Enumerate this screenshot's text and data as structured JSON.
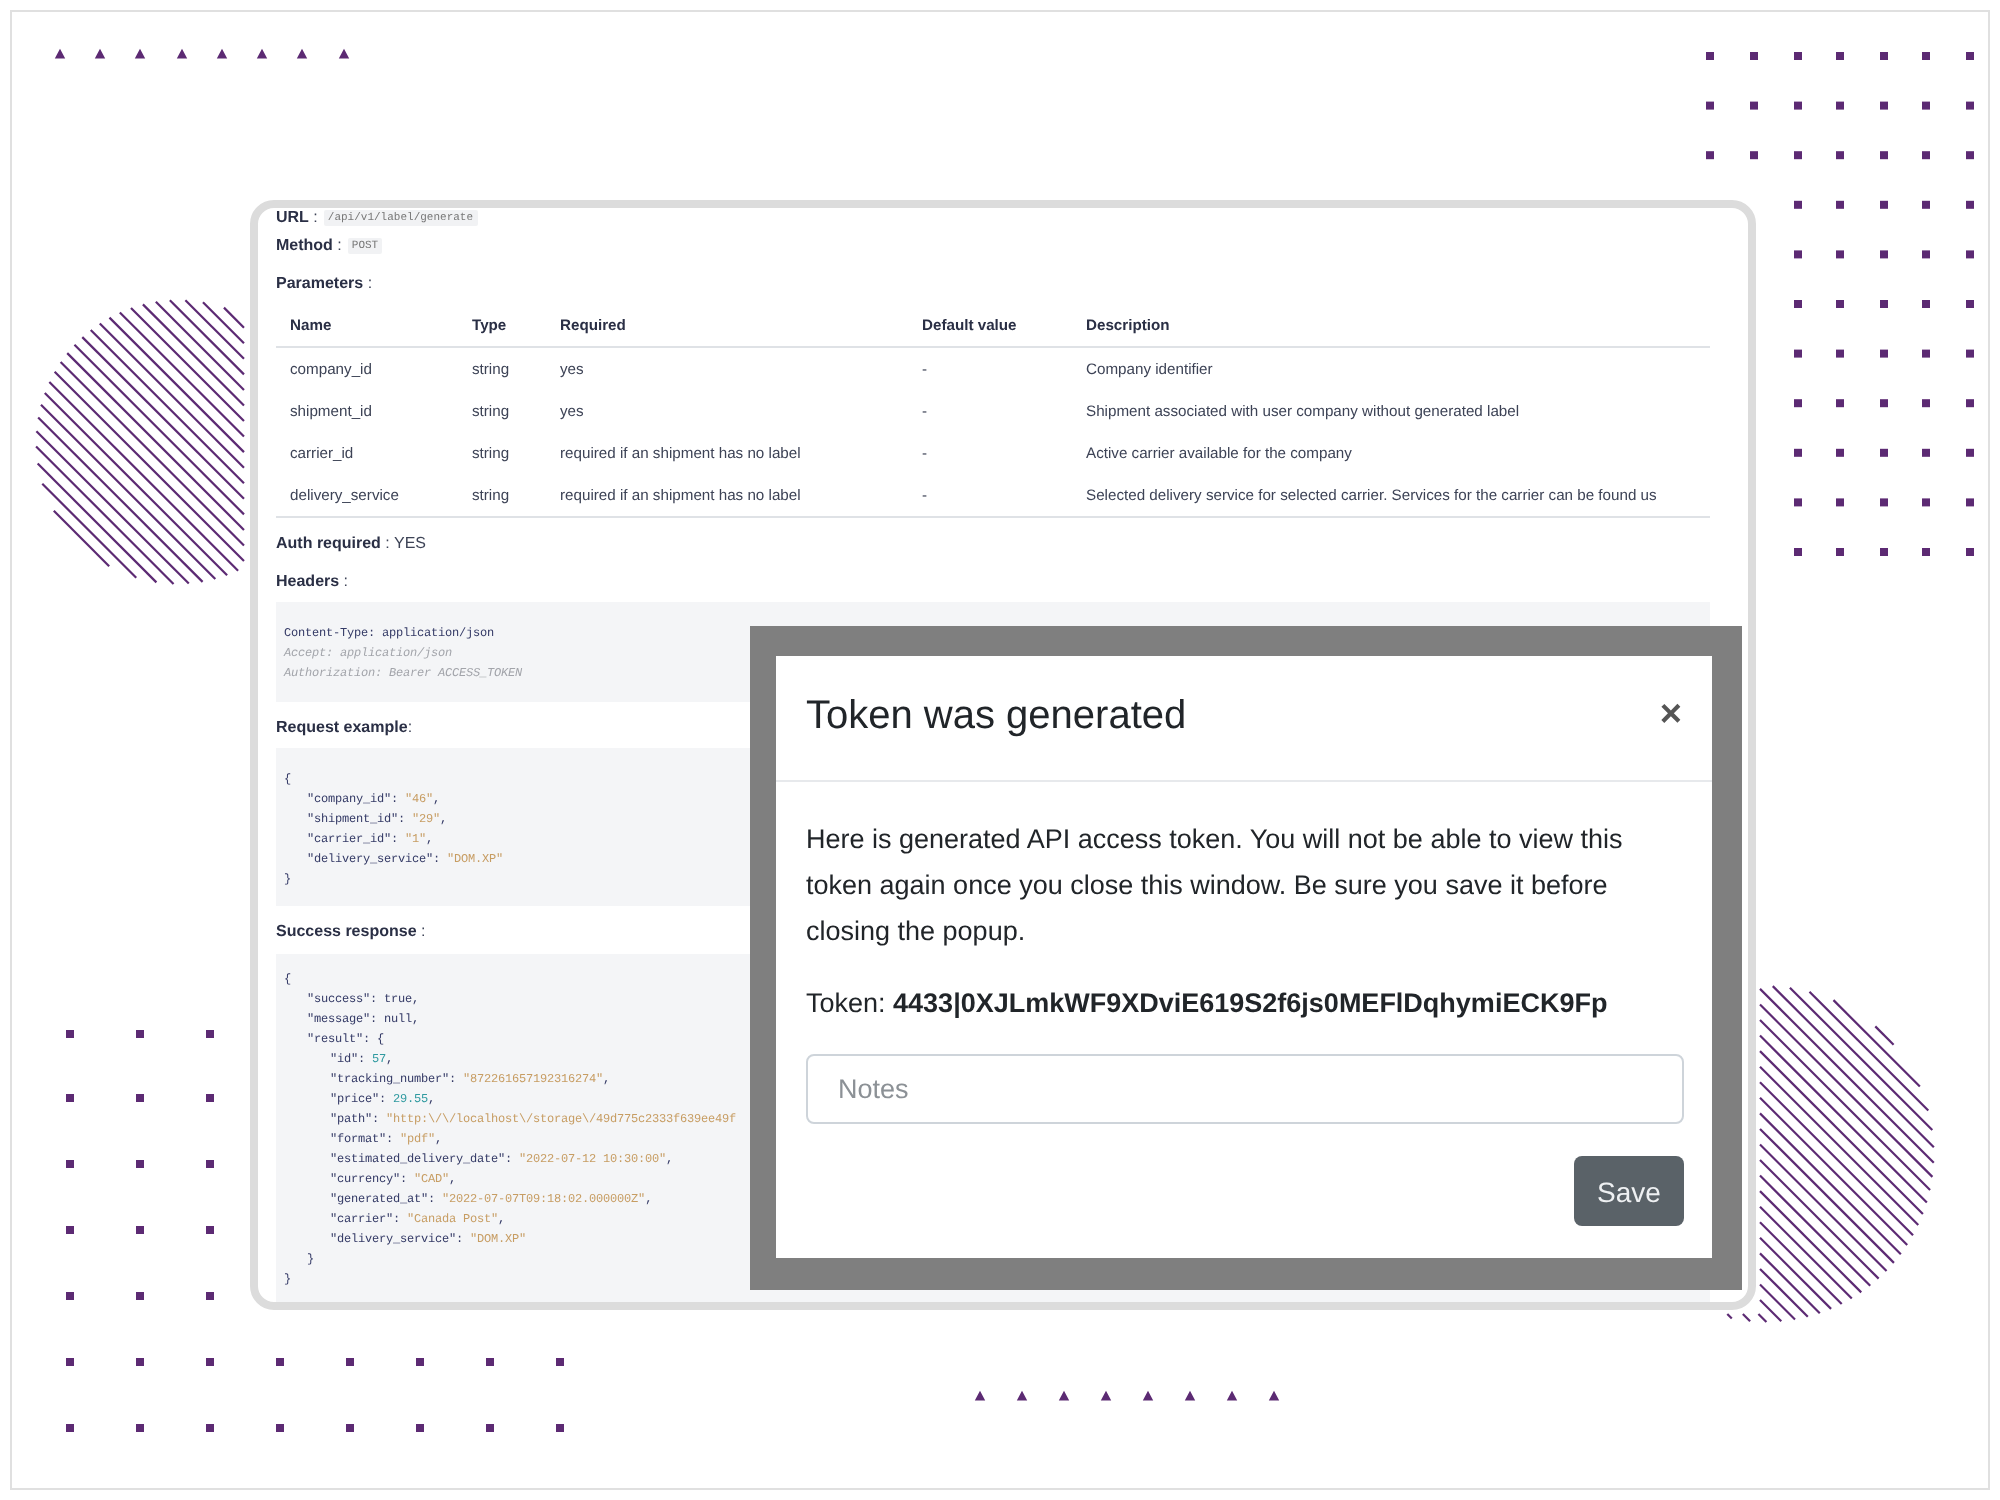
{
  "api_doc": {
    "url": {
      "label": "**URL** :",
      "value": "/api/v1/label/generate"
    },
    "method": {
      "label": "**Method** :",
      "value": "POST"
    },
    "parameters": {
      "heading": "**Parameters** :",
      "columns": [
        "Name",
        "Type",
        "Required",
        "Default value",
        "Description"
      ],
      "rows": [
        [
          "company_id",
          "string",
          "yes",
          "-",
          "Company identifier"
        ],
        [
          "shipment_id",
          "string",
          "yes",
          "-",
          "Shipment associated with user company without generated label"
        ],
        [
          "carrier_id",
          "string",
          "required if an shipment has no label",
          "-",
          "Active carrier available for the company"
        ],
        [
          "delivery_service",
          "string",
          "required if an shipment has no label",
          "-",
          "Selected delivery service for selected carrier. Services for the carrier can be found us"
        ]
      ]
    },
    "auth_required": "**Auth required** : YES",
    "headers": {
      "heading": "**Headers** :",
      "lines": [
        {
          "kind": "header",
          "text": "Content-Type: application/json"
        },
        {
          "kind": "comment",
          "text": "Accept: application/json"
        },
        {
          "kind": "comment",
          "text": "Authorization: Bearer ACCESS_TOKEN"
        }
      ]
    },
    "request_example": {
      "heading": "**Request example**:",
      "code": [
        {
          "kind": "brace",
          "text": "{",
          "children": [
            {
              "kind": "string",
              "key": "\"company_id\":",
              "value": "\"46\"",
              "tail": ","
            },
            {
              "kind": "string",
              "key": "\"shipment_id\":",
              "value": "\"29\"",
              "tail": ","
            },
            {
              "kind": "string",
              "key": "\"carrier_id\":",
              "value": "\"1\"",
              "tail": ","
            },
            {
              "kind": "string",
              "key": "\"delivery_service\":",
              "value": "\"DOM.XP\""
            }
          ]
        },
        {
          "kind": "brace",
          "text": "}"
        }
      ]
    },
    "success_response": {
      "heading": "**Success response** :",
      "code": [
        {
          "kind": "brace",
          "text": "{",
          "children": [
            {
              "kind": "literal",
              "key": "\"success\":",
              "value": "true",
              "tail": ","
            },
            {
              "kind": "literal",
              "key": "\"message\":",
              "value": "null",
              "tail": ","
            },
            {
              "kind": "object",
              "key": "\"result\":",
              "value": "{",
              "children": [
                {
                  "kind": "number",
                  "key": "\"id\":",
                  "value": "57",
                  "tail": ","
                },
                {
                  "kind": "string",
                  "key": "\"tracking_number\":",
                  "value": "\"872261657192316274\"",
                  "tail": ","
                },
                {
                  "kind": "number",
                  "key": "\"price\":",
                  "value": "29.55",
                  "tail": ","
                },
                {
                  "kind": "string",
                  "key": "\"path\":",
                  "value": "\"http:\\/\\/localhost\\/storage\\/49d775c2333f639ee49f"
                },
                {
                  "kind": "string",
                  "key": "\"format\":",
                  "value": "\"pdf\"",
                  "tail": ","
                },
                {
                  "kind": "string",
                  "key": "\"estimated_delivery_date\":",
                  "value": "\"2022-07-12 10:30:00\"",
                  "tail": ","
                },
                {
                  "kind": "string",
                  "key": "\"currency\":",
                  "value": "\"CAD\"",
                  "tail": ","
                },
                {
                  "kind": "string",
                  "key": "\"generated_at\":",
                  "value": "\"2022-07-07T09:18:02.000000Z\"",
                  "tail": ","
                },
                {
                  "kind": "string",
                  "key": "\"carrier\":",
                  "value": "\"Canada Post\"",
                  "tail": ","
                },
                {
                  "kind": "string",
                  "key": "\"delivery_service\":",
                  "value": "\"DOM.XP\""
                }
              ]
            },
            {
              "kind": "brace",
              "text": "}"
            }
          ]
        },
        {
          "kind": "brace",
          "text": "}"
        }
      ]
    }
  },
  "token_dialog": {
    "title": "Token was generated",
    "close": "×",
    "message": "Here is generated API access token. You will not be able to view this token again once you close this window. Be sure you save it before closing the popup.",
    "token": "Token: **4433|0XJLmkWF9XDviE619S2f6js0MEFlDqhymiECK9Fp**",
    "notes": {
      "placeholder": "Notes"
    },
    "save_button": "Save"
  }
}
